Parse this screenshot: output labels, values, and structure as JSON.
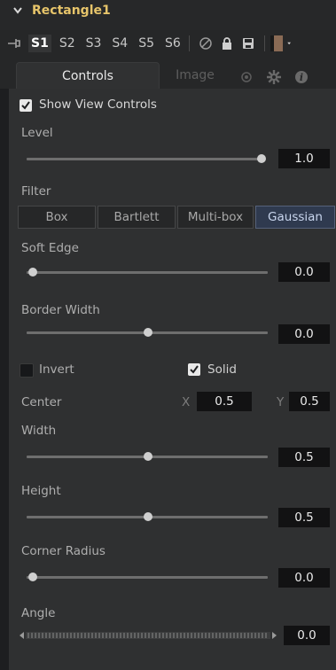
{
  "header": {
    "title": "Rectangle1"
  },
  "views": {
    "items": [
      "S1",
      "S2",
      "S3",
      "S4",
      "S5",
      "S6"
    ],
    "active": "S1"
  },
  "tabs": {
    "controls": "Controls",
    "image": "Image"
  },
  "show_view_controls": {
    "label": "Show View Controls",
    "checked": true
  },
  "level": {
    "label": "Level",
    "value": "1.0",
    "fraction": 1.0
  },
  "filter": {
    "label": "Filter",
    "options": [
      "Box",
      "Bartlett",
      "Multi-box",
      "Gaussian"
    ],
    "selected": "Gaussian"
  },
  "soft_edge": {
    "label": "Soft Edge",
    "value": "0.0",
    "fraction": 0.0
  },
  "border_width": {
    "label": "Border Width",
    "value": "0.0",
    "fraction": 0.5
  },
  "invert": {
    "label": "Invert",
    "checked": false
  },
  "solid": {
    "label": "Solid",
    "checked": true
  },
  "center": {
    "label": "Center",
    "x_label": "X",
    "x_value": "0.5",
    "y_label": "Y",
    "y_value": "0.5"
  },
  "width": {
    "label": "Width",
    "value": "0.5",
    "fraction": 0.5
  },
  "height": {
    "label": "Height",
    "value": "0.5",
    "fraction": 0.5
  },
  "corner_radius": {
    "label": "Corner Radius",
    "value": "0.0",
    "fraction": 0.0
  },
  "angle": {
    "label": "Angle",
    "value": "0.0"
  }
}
